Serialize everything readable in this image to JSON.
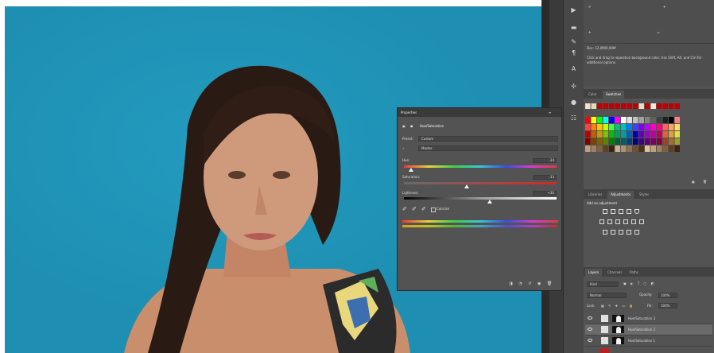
{
  "history": {
    "doc_line": "Doc: 12,0M/0,00M",
    "hint": "Click and drag to reposition background color. Use Shift, Alt, and Ctrl for additional options."
  },
  "swatches_panel": {
    "tabs": [
      "Color",
      "Swatches"
    ]
  },
  "adjustments_panel": {
    "tabs": [
      "Libraries",
      "Adjustments",
      "Styles"
    ],
    "add_label": "Add an adjustment"
  },
  "properties": {
    "title": "Properties",
    "header": "Hue/Saturation",
    "preset_label": "Preset:",
    "preset_value": "Custom",
    "channel_value": "Master",
    "hue_label": "Hue:",
    "hue_value": "-34",
    "saturation_label": "Saturation:",
    "saturation_value": "-33",
    "lightness_label": "Lightness:",
    "lightness_value": "+30",
    "colorize_label": "Colorize"
  },
  "layers_panel": {
    "tabs": [
      "Layers",
      "Channels",
      "Paths"
    ],
    "kind": "Kind",
    "blend_mode": "Normal",
    "opacity_label": "Opacity:",
    "opacity_value": "100%",
    "lock_label": "Lock:",
    "fill_label": "Fill:",
    "fill_value": "100%",
    "layers": [
      {
        "name": "Hue/Saturation 3"
      },
      {
        "name": "Hue/Saturation 2"
      },
      {
        "name": "Hue/Saturation 1"
      }
    ]
  },
  "colors": {
    "canvas_bg": "#1e8fb2",
    "panel_bg": "#535353",
    "panel_dark": "#424242"
  }
}
